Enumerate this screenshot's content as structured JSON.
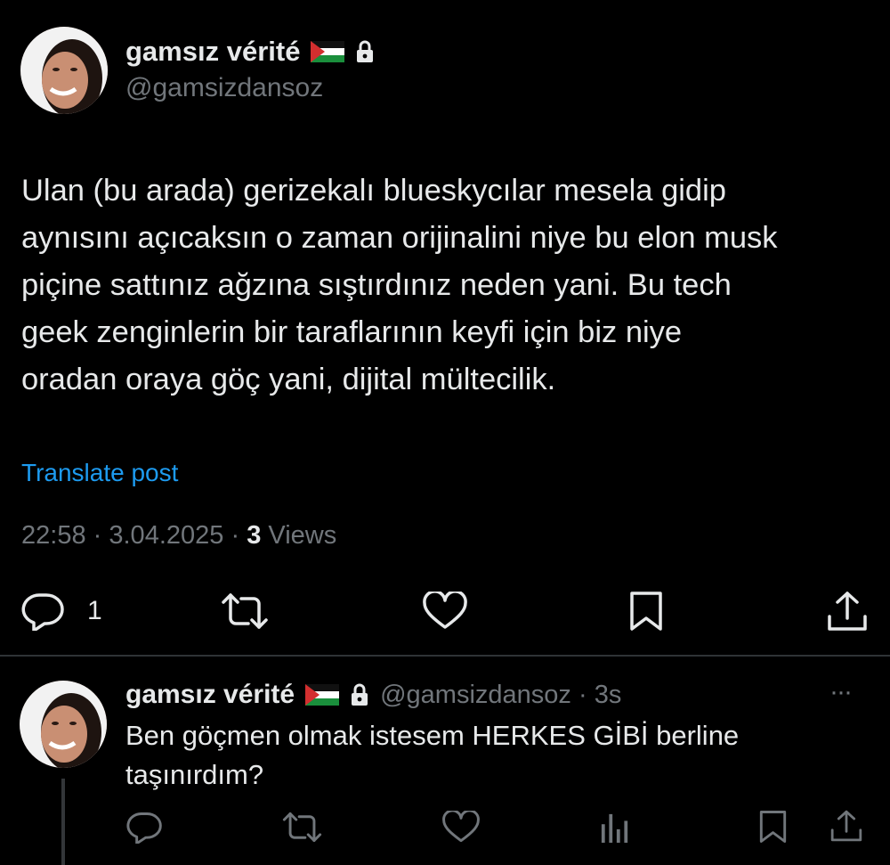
{
  "main_post": {
    "display_name": "gamsız vérité",
    "handle": "@gamsizdansoz",
    "text_lines": [
      "Ulan (bu arada) gerizekalı blueskycılar mesela gidip",
      "aynısını açıcaksın o zaman orijinalini niye bu elon musk",
      "piçine sattınız ağzına sıştırdınız neden yani. Bu tech",
      "geek zenginlerin bir taraflarının keyfi için biz niye",
      "oradan oraya göç yani, dijital mültecilik."
    ],
    "translate_label": "Translate post",
    "time": "22:58",
    "date": "3.04.2025",
    "views_count": "3",
    "views_label": "Views",
    "separator": "·",
    "reply_count": "1"
  },
  "reply": {
    "display_name": "gamsız vérité",
    "handle": "@gamsizdansoz",
    "separator": "·",
    "age": "3s",
    "more": "···",
    "text_lines": [
      "Ben göçmen olmak istesem HERKES GİBİ berline",
      "taşınırdım?"
    ]
  },
  "colors": {
    "background": "#000000",
    "text": "#e7e9ea",
    "muted": "#71767b",
    "link": "#1d9bf0",
    "divider": "#2f3336"
  },
  "icons": [
    "flag-palestine-icon",
    "lock-icon",
    "reply-icon",
    "repost-icon",
    "like-icon",
    "bookmark-icon",
    "share-icon",
    "views-icon",
    "more-icon"
  ]
}
